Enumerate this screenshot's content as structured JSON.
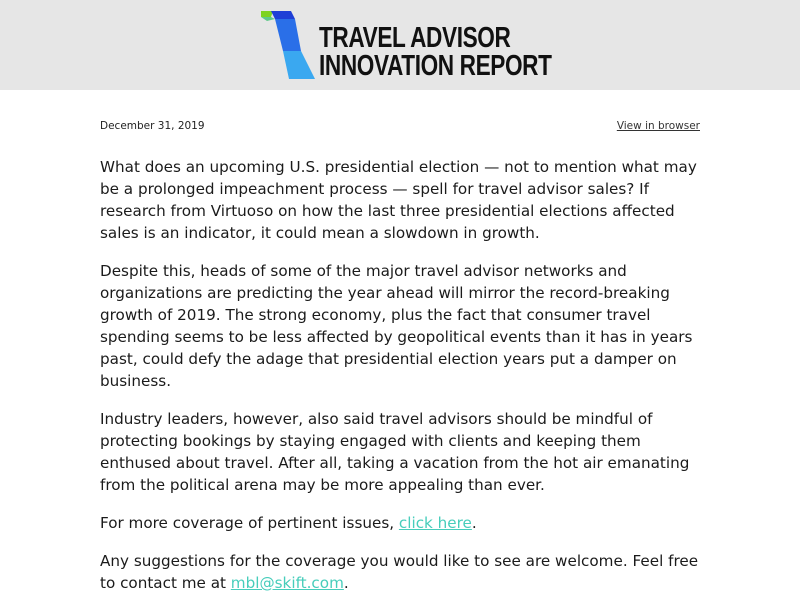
{
  "brand": {
    "line1": "TRAVEL ADVISOR",
    "line2": "INNOVATION REPORT",
    "colors": {
      "green": "#7ed321",
      "blue_dark": "#1f3fd6",
      "blue_light": "#3aa8f0",
      "header_bg": "#e6e6e6"
    },
    "icon": "skift-t-logo-icon"
  },
  "meta": {
    "date": "December 31, 2019",
    "view_in_browser": "View in browser"
  },
  "body": {
    "p1": "What does an upcoming U.S. presidential election — not to mention what may be a prolonged impeachment process — spell for travel advisor sales? If research from Virtuoso on how the last three presidential elections affected sales is an indicator, it could mean a slowdown in growth.",
    "p2": "Despite this, heads of some of the major travel advisor networks and organizations are predicting the year ahead will mirror the record-breaking growth of 2019. The strong economy, plus the fact that consumer travel spending seems to be less affected by geopolitical events than it has in years past, could defy the adage that presidential election years put a damper on business.",
    "p3": "Industry leaders, however, also said travel advisors should be mindful of protecting bookings by staying engaged with clients and keeping them enthused about travel. After all, taking a vacation from the hot air emanating from the political arena may be more appealing than ever.",
    "p4_prefix": "For more coverage of pertinent issues, ",
    "p4_link": "click here",
    "p4_suffix": ".",
    "p5_prefix": "Any suggestions for the coverage you would like to see are welcome. Feel free to contact me at ",
    "p5_link": "mbl@skift.com",
    "p5_suffix": ".",
    "link_color": "#47cdbb"
  }
}
